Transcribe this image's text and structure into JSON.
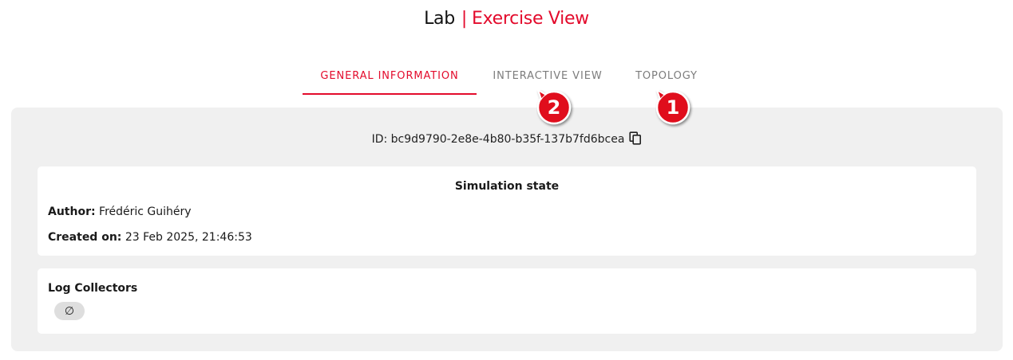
{
  "header": {
    "app_name": "Lab",
    "separator": "|",
    "view_title": "Exercise View"
  },
  "tabs": [
    {
      "label": "GENERAL INFORMATION",
      "active": true
    },
    {
      "label": "INTERACTIVE VIEW",
      "active": false
    },
    {
      "label": "TOPOLOGY",
      "active": false
    }
  ],
  "annotations": [
    {
      "number": "2",
      "points_to": "INTERACTIVE VIEW"
    },
    {
      "number": "1",
      "points_to": "TOPOLOGY"
    }
  ],
  "exercise": {
    "id_text": "ID: bc9d9790-2e8e-4b80-b35f-137b7fd6bcea",
    "copy_icon": "copy-icon"
  },
  "simulation_card": {
    "title": "Simulation state",
    "author_label": "Author:",
    "author_value": "Frédéric Guihéry",
    "created_label": "Created on:",
    "created_value": "23 Feb 2025, 21:46:53"
  },
  "log_collectors_card": {
    "title": "Log Collectors",
    "empty_chip": "∅"
  },
  "colors": {
    "accent": "#e30b2c",
    "panel_bg": "#f0f0f0",
    "tab_inactive": "#7c7c7c",
    "marker_red": "#e0101e"
  }
}
